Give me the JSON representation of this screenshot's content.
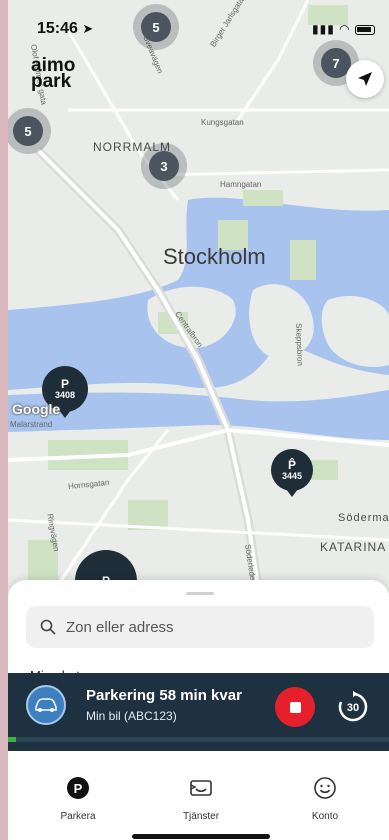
{
  "status_bar": {
    "time": "15:46",
    "icons": "signal wifi battery"
  },
  "brand": {
    "logo_line1": "aimo",
    "logo_line2": "park"
  },
  "map": {
    "city": "Stockholm",
    "districts": [
      "NORRMALM",
      "Södermalm",
      "KATARINA"
    ],
    "streets": [
      "Sveavägen",
      "Kungsgatan",
      "Hamngatan",
      "Centralbron",
      "Skeppsbron",
      "Hornsgatan",
      "Ringvägen",
      "Söderleden",
      "Malarstrand",
      "Olof Palmes gata",
      "Birger Jarlsgatan"
    ],
    "clusters": [
      "5",
      "7",
      "5",
      "3"
    ],
    "pins": [
      {
        "label": "3408"
      },
      {
        "label": "3445"
      },
      {
        "label": ""
      }
    ],
    "attribution": "Google",
    "colors": {
      "water": "#a8c3ee",
      "land": "#e9ece8",
      "park": "#cfe3c4"
    }
  },
  "sheet": {
    "search_placeholder": "Zon eller adress",
    "list_peek": "Mina hot..."
  },
  "parking": {
    "title": "Parkering 58 min kvar",
    "vehicle": "Min bil (ABC123)",
    "extend_label": "30",
    "progress": 0.02,
    "colors": {
      "banner": "#1d3140",
      "stop": "#e5202a",
      "progress": "#3fb04a"
    }
  },
  "tabs": [
    {
      "label": "Parkera",
      "icon": "parking-icon"
    },
    {
      "label": "Tjänster",
      "icon": "ticket-icon"
    },
    {
      "label": "Konto",
      "icon": "smiley-icon"
    }
  ]
}
